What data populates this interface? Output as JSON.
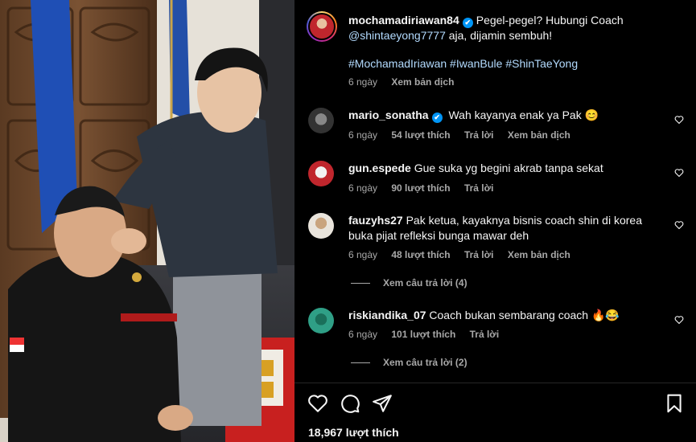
{
  "post": {
    "author": "mochamadiriawan84",
    "caption_text": "Pegel-pegel? Hubungi Coach",
    "mention": "@shintaeyong7777",
    "caption_rest": "aja, dijamin sembuh!",
    "hashtags": "#MochamadIriawan #IwanBule #ShinTaeYong",
    "time": "6 ngày",
    "translate": "Xem bản dịch",
    "likes": "18,967 lượt thích"
  },
  "comments": [
    {
      "user": "mario_sonatha",
      "verified": true,
      "text": "Wah kayanya enak ya Pak 😊",
      "time": "6 ngày",
      "likes": "54 lượt thích",
      "reply": "Trả lời",
      "translate": "Xem bản dịch",
      "avatar_icon": "avatar-icon"
    },
    {
      "user": "gun.espede",
      "verified": false,
      "text": "Gue suka yg begini akrab tanpa sekat",
      "time": "6 ngày",
      "likes": "90 lượt thích",
      "reply": "Trả lời",
      "avatar_icon": "avatar-icon"
    },
    {
      "user": "fauzyhs27",
      "verified": false,
      "text_line1": "Pak ketua, kayaknya bisnis coach shin di korea",
      "text_line2": "buka pijat refleksi bunga mawar deh",
      "time": "6 ngày",
      "likes": "48 lượt thích",
      "reply": "Trả lời",
      "translate": "Xem bản dịch",
      "view_replies": "Xem câu trả lời (4)",
      "avatar_icon": "avatar-icon"
    },
    {
      "user": "riskiandika_07",
      "verified": false,
      "text": "Coach bukan sembarang coach 🔥😂",
      "time": "6 ngày",
      "likes": "101 lượt thích",
      "reply": "Trả lời",
      "view_replies": "Xem câu trả lời (2)",
      "avatar_icon": "avatar-icon"
    }
  ],
  "icons": {
    "like": "heart-icon",
    "comment": "comment-icon",
    "share": "send-icon",
    "save": "bookmark-icon",
    "verified_glyph": "✔"
  },
  "colors": {
    "background": "#000000",
    "text": "#f5f5f5",
    "secondary": "#a8a8a8",
    "link": "#b3dbff",
    "verified": "#0095f6"
  }
}
